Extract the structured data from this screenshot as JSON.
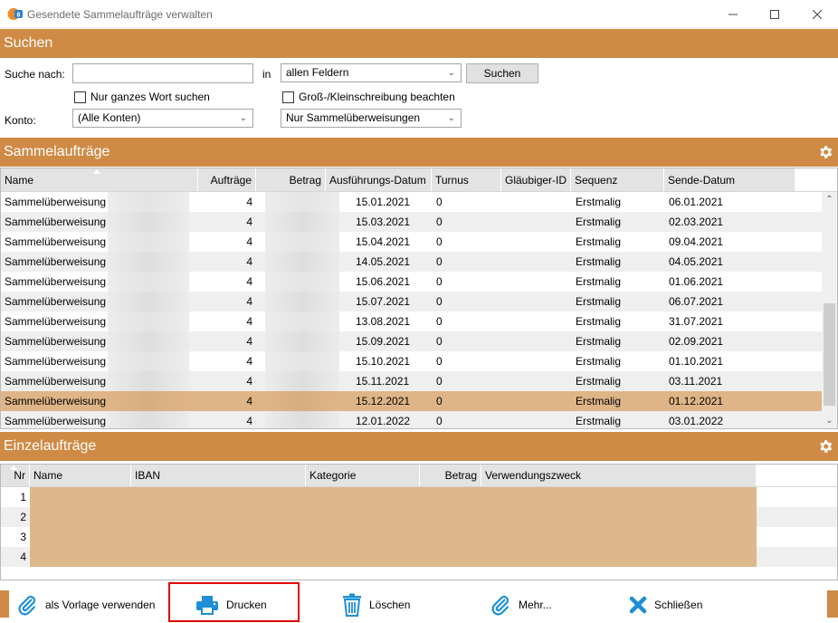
{
  "window": {
    "title": "Gesendete Sammelaufträge verwalten"
  },
  "search_section": {
    "header": "Suchen",
    "search_label": "Suche nach:",
    "search_value": "",
    "in_label": "in",
    "field_select": "allen Feldern",
    "search_button": "Suchen",
    "whole_word_label": "Nur ganzes Wort suchen",
    "case_label": "Groß-/Kleinschreibung beachten",
    "account_label": "Konto:",
    "account_select": "(Alle Konten)",
    "type_select": "Nur Sammelüberweisungen"
  },
  "sammelauftraege": {
    "header": "Sammelaufträge",
    "columns": [
      "Name",
      "Aufträge",
      "Betrag",
      "Ausführungs-Datum",
      "Turnus",
      "Gläubiger-ID",
      "Sequenz",
      "Sende-Datum"
    ],
    "rows": [
      {
        "name": "Sammelüberweisung",
        "auftraege": "4",
        "ausfuehrung": "15.01.2021",
        "turnus": "0",
        "sequenz": "Erstmalig",
        "sende": "06.01.2021"
      },
      {
        "name": "Sammelüberweisung",
        "auftraege": "4",
        "ausfuehrung": "15.03.2021",
        "turnus": "0",
        "sequenz": "Erstmalig",
        "sende": "02.03.2021"
      },
      {
        "name": "Sammelüberweisung",
        "auftraege": "4",
        "ausfuehrung": "15.04.2021",
        "turnus": "0",
        "sequenz": "Erstmalig",
        "sende": "09.04.2021"
      },
      {
        "name": "Sammelüberweisung",
        "auftraege": "4",
        "ausfuehrung": "14.05.2021",
        "turnus": "0",
        "sequenz": "Erstmalig",
        "sende": "04.05.2021"
      },
      {
        "name": "Sammelüberweisung",
        "auftraege": "4",
        "ausfuehrung": "15.06.2021",
        "turnus": "0",
        "sequenz": "Erstmalig",
        "sende": "01.06.2021"
      },
      {
        "name": "Sammelüberweisung",
        "auftraege": "4",
        "ausfuehrung": "15.07.2021",
        "turnus": "0",
        "sequenz": "Erstmalig",
        "sende": "06.07.2021"
      },
      {
        "name": "Sammelüberweisung",
        "auftraege": "4",
        "ausfuehrung": "13.08.2021",
        "turnus": "0",
        "sequenz": "Erstmalig",
        "sende": "31.07.2021"
      },
      {
        "name": "Sammelüberweisung",
        "auftraege": "4",
        "ausfuehrung": "15.09.2021",
        "turnus": "0",
        "sequenz": "Erstmalig",
        "sende": "02.09.2021"
      },
      {
        "name": "Sammelüberweisung",
        "auftraege": "4",
        "ausfuehrung": "15.10.2021",
        "turnus": "0",
        "sequenz": "Erstmalig",
        "sende": "01.10.2021"
      },
      {
        "name": "Sammelüberweisung",
        "auftraege": "4",
        "ausfuehrung": "15.11.2021",
        "turnus": "0",
        "sequenz": "Erstmalig",
        "sende": "03.11.2021"
      },
      {
        "name": "Sammelüberweisung",
        "auftraege": "4",
        "ausfuehrung": "15.12.2021",
        "turnus": "0",
        "sequenz": "Erstmalig",
        "sende": "01.12.2021",
        "selected": true
      },
      {
        "name": "Sammelüberweisung",
        "auftraege": "4",
        "ausfuehrung": "12.01.2022",
        "turnus": "0",
        "sequenz": "Erstmalig",
        "sende": "03.01.2022"
      }
    ]
  },
  "einzelauftraege": {
    "header": "Einzelaufträge",
    "columns": [
      "Nr",
      "Name",
      "IBAN",
      "Kategorie",
      "Betrag",
      "Verwendungszweck"
    ],
    "rows": [
      "1",
      "2",
      "3",
      "4"
    ]
  },
  "toolbar": {
    "template_label": "als Vorlage verwenden",
    "print_label": "Drucken",
    "delete_label": "Löschen",
    "more_label": "Mehr...",
    "close_label": "Schließen"
  },
  "colors": {
    "accent": "#cf8a45",
    "selection": "#dfb587",
    "icon_blue": "#1e8fd6",
    "highlight": "#e00000"
  }
}
